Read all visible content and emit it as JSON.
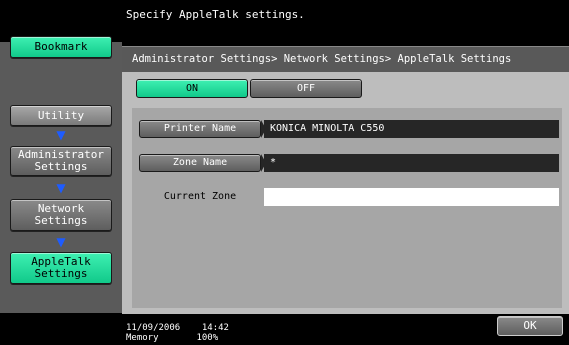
{
  "header": {
    "message": "Specify AppleTalk settings."
  },
  "sidebar": {
    "bookmark_label": "Bookmark",
    "items": [
      {
        "label": "Utility"
      },
      {
        "label": "Administrator Settings"
      },
      {
        "label": "Network Settings"
      },
      {
        "label": "AppleTalk Settings"
      }
    ]
  },
  "panel": {
    "breadcrumb": "Administrator Settings> Network Settings> AppleTalk Settings",
    "toggle": {
      "on_label": "ON",
      "off_label": "OFF",
      "selected": "ON"
    },
    "fields": [
      {
        "label": "Printer Name",
        "value": "KONICA MINOLTA C550"
      },
      {
        "label": "Zone Name",
        "value": "*"
      },
      {
        "label": "Current Zone",
        "value": ""
      }
    ]
  },
  "footer": {
    "date": "11/09/2006",
    "time": "14:42",
    "memory_label": "Memory",
    "memory_value": "100%",
    "ok_label": "OK"
  },
  "colors": {
    "accent": "#19d99a",
    "arrow": "#1e5cff"
  }
}
